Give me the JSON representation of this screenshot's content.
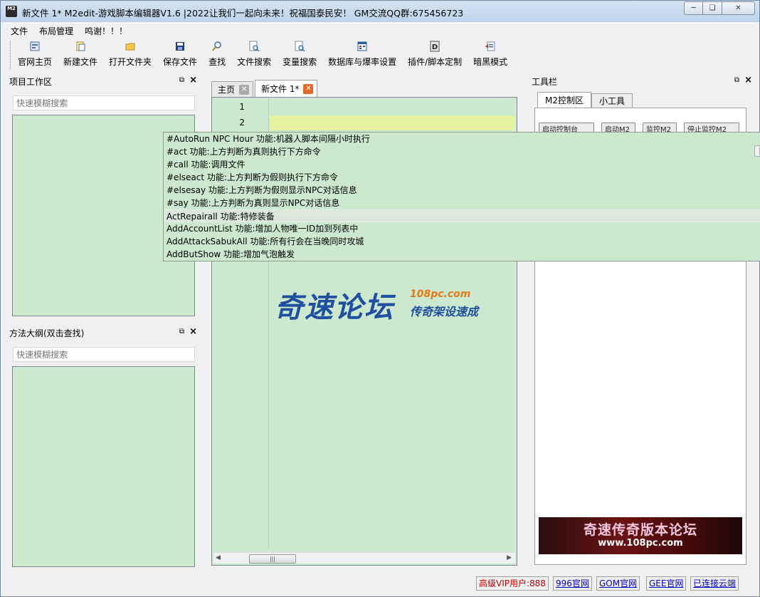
{
  "window": {
    "title": "新文件 1*  M2edit-游戏脚本编辑器V1.6 |2022让我们一起向未来！祝福国泰民安！ GM交流QQ群:675456723",
    "icon_text": "M2"
  },
  "menubar": {
    "items": [
      "文件",
      "布局管理",
      "鸣谢！！！"
    ]
  },
  "toolbar": {
    "items": [
      {
        "label": "官网主页",
        "icon": "home-page-icon"
      },
      {
        "label": "新建文件",
        "icon": "new-file-icon"
      },
      {
        "label": "打开文件夹",
        "icon": "folder-icon"
      },
      {
        "label": "保存文件",
        "icon": "save-icon"
      },
      {
        "label": "查找",
        "icon": "search-icon"
      },
      {
        "label": "文件搜索",
        "icon": "file-search-icon"
      },
      {
        "label": "变量搜索",
        "icon": "variable-search-icon"
      },
      {
        "label": "数据库与爆率设置",
        "icon": "database-icon"
      },
      {
        "label": "插件/脚本定制",
        "icon": "plugin-icon"
      },
      {
        "label": "暗黑模式",
        "icon": "dark-mode-icon"
      }
    ]
  },
  "left_top_dock": {
    "title": "项目工作区",
    "search_placeholder": "快速模糊搜索"
  },
  "left_bottom_dock": {
    "title": "方法大纲(双击查找)",
    "search_placeholder": "快速模糊搜索"
  },
  "editor": {
    "tabs": [
      {
        "label": "主页",
        "active": false
      },
      {
        "label": "新文件 1*",
        "active": true
      }
    ],
    "line_numbers": [
      "1",
      "2"
    ],
    "watermark": {
      "big": "奇速论坛",
      "url": "108pc.com",
      "sub": "传奇架设速成"
    }
  },
  "autocomplete": {
    "items": [
      "#AutoRun NPC Hour 功能:机器人脚本间隔小时执行",
      "#act 功能:上方判断为真则执行下方命令",
      "#call 功能:调用文件",
      "#elseact 功能:上方判断为假则执行下方命令",
      "#elsesay 功能:上方判断为假则显示NPC对话信息",
      "#say 功能:上方判断为真则显示NPC对话信息",
      "ActRepairall 功能:特修装备",
      "AddAccountList 功能:增加人物唯一ID加到列表中",
      "AddAttackSabukAll 功能:所有行会在当晚同时攻城",
      "AddButShow 功能:增加气泡触发"
    ],
    "selected_index": 6
  },
  "right_dock": {
    "title": "工具栏",
    "tabs": [
      "M2控制区",
      "小工具"
    ],
    "buttons": [
      "启动控制台",
      "启动M2",
      "监控M2",
      "停止监控M2"
    ],
    "banner": {
      "title": "奇速传奇版本论坛",
      "url": "www.108pc.com"
    }
  },
  "statusbar": {
    "vip": "高级VIP用户:888",
    "links": [
      "996官网",
      "GOM官网",
      "GEE官网",
      "已连接云端"
    ]
  },
  "colors": {
    "editor_bg": "#cce8cf",
    "line_highlight": "#e6f2a0",
    "tab_close_active": "#e06c2c",
    "vip_text": "#c00000",
    "link_text": "#0000cc"
  }
}
